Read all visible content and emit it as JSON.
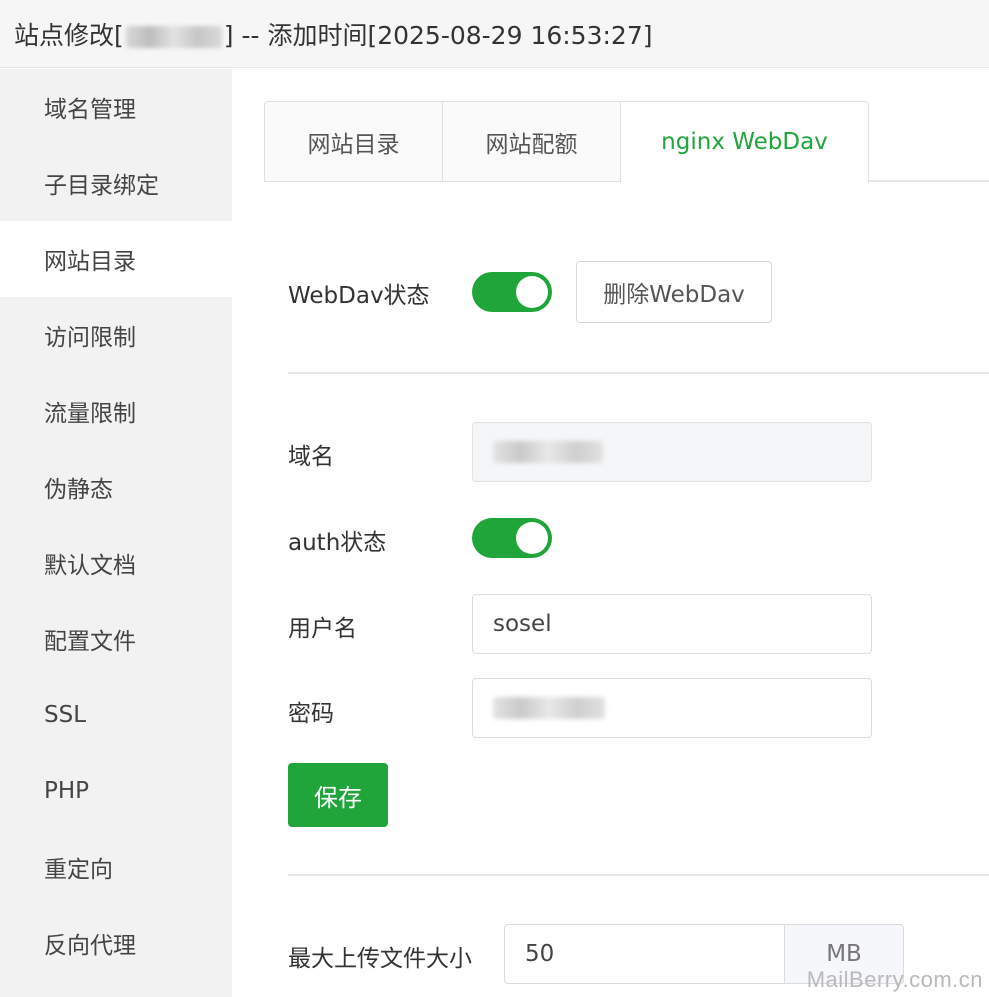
{
  "window": {
    "title_prefix": "站点修改[",
    "title_suffix": "] -- 添加时间[2025-08-29 16:53:27]"
  },
  "sidebar": {
    "items": [
      {
        "label": "域名管理"
      },
      {
        "label": "子目录绑定"
      },
      {
        "label": "网站目录"
      },
      {
        "label": "访问限制"
      },
      {
        "label": "流量限制"
      },
      {
        "label": "伪静态"
      },
      {
        "label": "默认文档"
      },
      {
        "label": "配置文件"
      },
      {
        "label": "SSL"
      },
      {
        "label": "PHP"
      },
      {
        "label": "重定向"
      },
      {
        "label": "反向代理"
      }
    ],
    "active_item": "网站目录"
  },
  "tabs": [
    {
      "label": "网站目录"
    },
    {
      "label": "网站配额"
    },
    {
      "label": "nginx WebDav"
    }
  ],
  "active_tab": "nginx WebDav",
  "webdav": {
    "status_label": "WebDav状态",
    "status_on": true,
    "delete_button": "删除WebDav",
    "domain_label": "域名",
    "auth_label": "auth状态",
    "auth_on": true,
    "username_label": "用户名",
    "username_value": "sosel",
    "password_label": "密码",
    "save_button": "保存",
    "max_upload_label": "最大上传文件大小",
    "max_upload_value": "50",
    "max_upload_unit": "MB"
  },
  "watermark": "MailBerry.com.cn",
  "colors": {
    "accent": "#20a53a",
    "sidebar_bg": "#f2f2f2",
    "titlebar_bg": "#f6f6f6"
  }
}
